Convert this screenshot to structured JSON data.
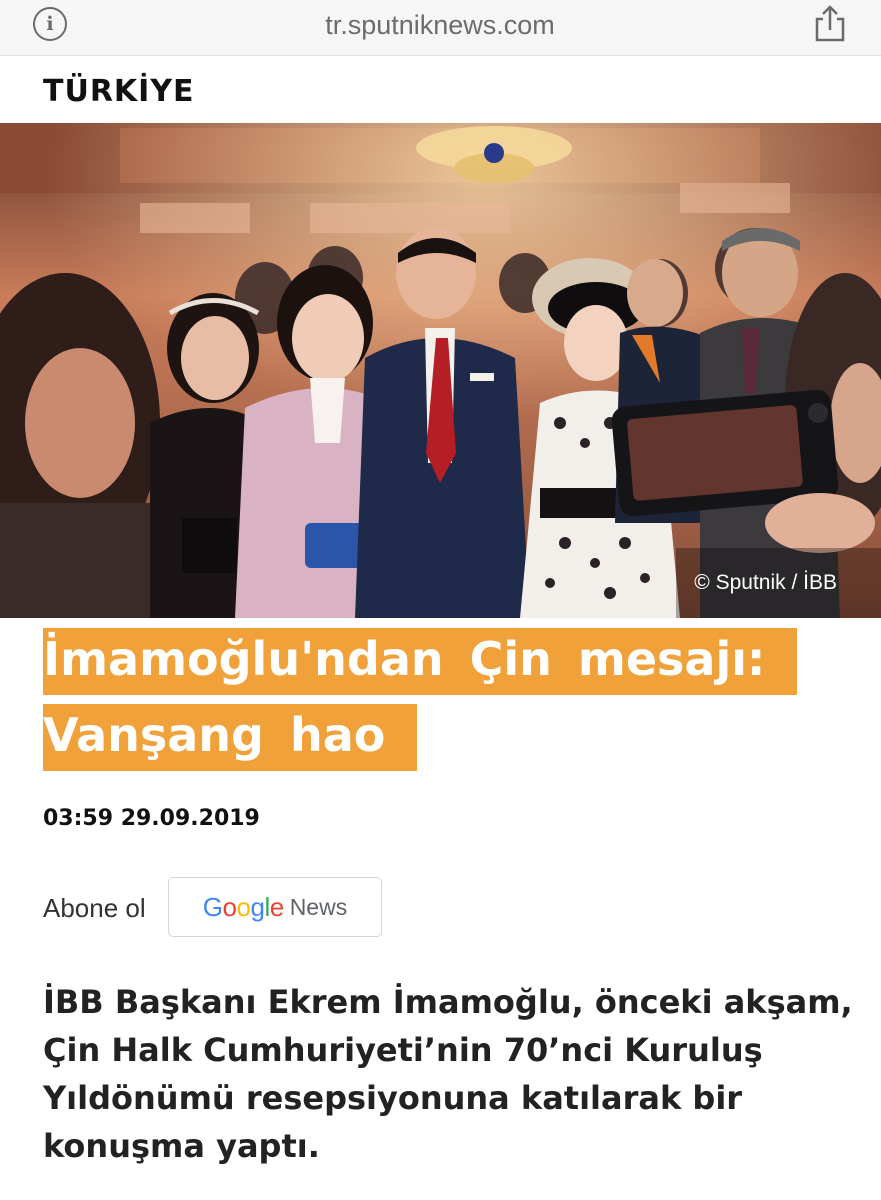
{
  "browser": {
    "url": "tr.sputniknews.com",
    "info_icon": "info-icon",
    "share_icon": "share-icon"
  },
  "section": {
    "label": "TÜRKİYE"
  },
  "hero": {
    "credit": "© Sputnik / İBB"
  },
  "article": {
    "headline_line1": "İmamoğlu'ndan Çin mesajı:",
    "headline_line2": "Vanşang hao",
    "datetime": "03:59 29.09.2019",
    "subscribe_label": "Abone ol",
    "google_news": {
      "brand": [
        "G",
        "o",
        "o",
        "g",
        "l",
        "e"
      ],
      "brand_colors": [
        "#4285F4",
        "#EA4335",
        "#FBBC05",
        "#4285F4",
        "#34A853",
        "#EA4335"
      ],
      "news": "News"
    },
    "lead": "İBB Başkanı Ekrem İmamoğlu, önceki akşam, Çin Halk Cumhuriyeti’nin 70’nci Kuruluş Yıldönümü resepsiyonuna katılarak bir konuşma yaptı."
  },
  "colors": {
    "accent": "#f0a13a",
    "headline_text": "#ffffff"
  }
}
